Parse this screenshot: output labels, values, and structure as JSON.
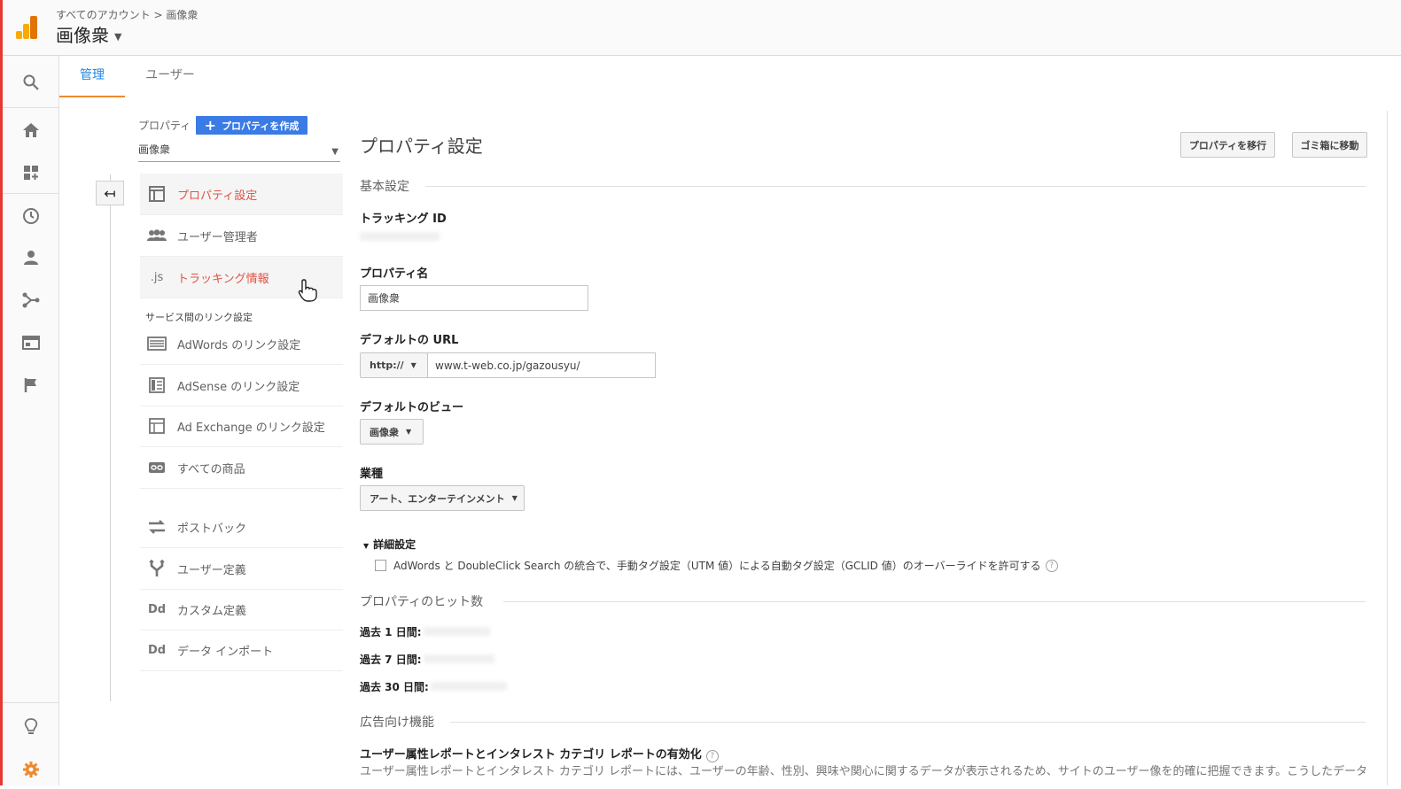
{
  "header": {
    "breadcrumb_root": "すべてのアカウント",
    "breadcrumb_sep": ">",
    "breadcrumb_current": "画像衆",
    "account_name": "画像衆"
  },
  "tabs": [
    {
      "label": "管理",
      "active": true
    },
    {
      "label": "ユーザー",
      "active": false
    }
  ],
  "property": {
    "label": "プロパティ",
    "create_button": "プロパティを作成",
    "selected": "画像衆"
  },
  "nav": {
    "items": [
      {
        "label": "プロパティ設定",
        "icon": "layout-icon"
      },
      {
        "label": "ユーザー管理者",
        "icon": "people-icon"
      },
      {
        "label": "トラッキング情報",
        "icon": ".js"
      }
    ],
    "section_label": "サービス間のリンク設定",
    "link_items": [
      {
        "label": "AdWords のリンク設定"
      },
      {
        "label": "AdSense のリンク設定"
      },
      {
        "label": "Ad Exchange のリンク設定"
      },
      {
        "label": "すべての商品"
      }
    ],
    "other_items": [
      {
        "label": "ポストバック"
      },
      {
        "label": "ユーザー定義"
      },
      {
        "label": "カスタム定義",
        "icon": "Dd"
      },
      {
        "label": "データ インポート",
        "icon": "Dd"
      }
    ]
  },
  "main": {
    "title": "プロパティ設定",
    "move_button": "プロパティを移行",
    "trash_button": "ゴミ箱に移動",
    "basic_section": "基本設定",
    "tracking_id_label": "トラッキング ID",
    "property_name_label": "プロパティ名",
    "property_name_value": "画像衆",
    "default_url_label": "デフォルトの URL",
    "protocol": "http://",
    "url_value": "www.t-web.co.jp/gazousyu/",
    "default_view_label": "デフォルトのビュー",
    "default_view_value": "画像衆",
    "industry_label": "業種",
    "industry_value": "アート、エンターテインメント",
    "advanced_label": "詳細設定",
    "checkbox_text": "AdWords と DoubleClick Search の統合で、手動タグ設定（UTM 値）による自動タグ設定（GCLID 値）のオーバーライドを許可する",
    "hits_section": "プロパティのヒット数",
    "hits_1day": "過去 1 日間:",
    "hits_7day": "過去 7 日間:",
    "hits_30day": "過去 30 日間:",
    "ads_section": "広告向け機能",
    "demographics_label": "ユーザー属性レポートとインタレスト カテゴリ レポートの有効化",
    "demographics_desc": "ユーザー属性レポートとインタレスト カテゴリ レポートには、ユーザーの年齢、性別、興味や関心に関するデータが表示されるため、サイトのユーザー像を的確に把握できます。こうしたデータ"
  },
  "colors": {
    "accent_blue": "#3a7be6",
    "active_red": "#e05243",
    "orange": "#ef8a2c"
  }
}
